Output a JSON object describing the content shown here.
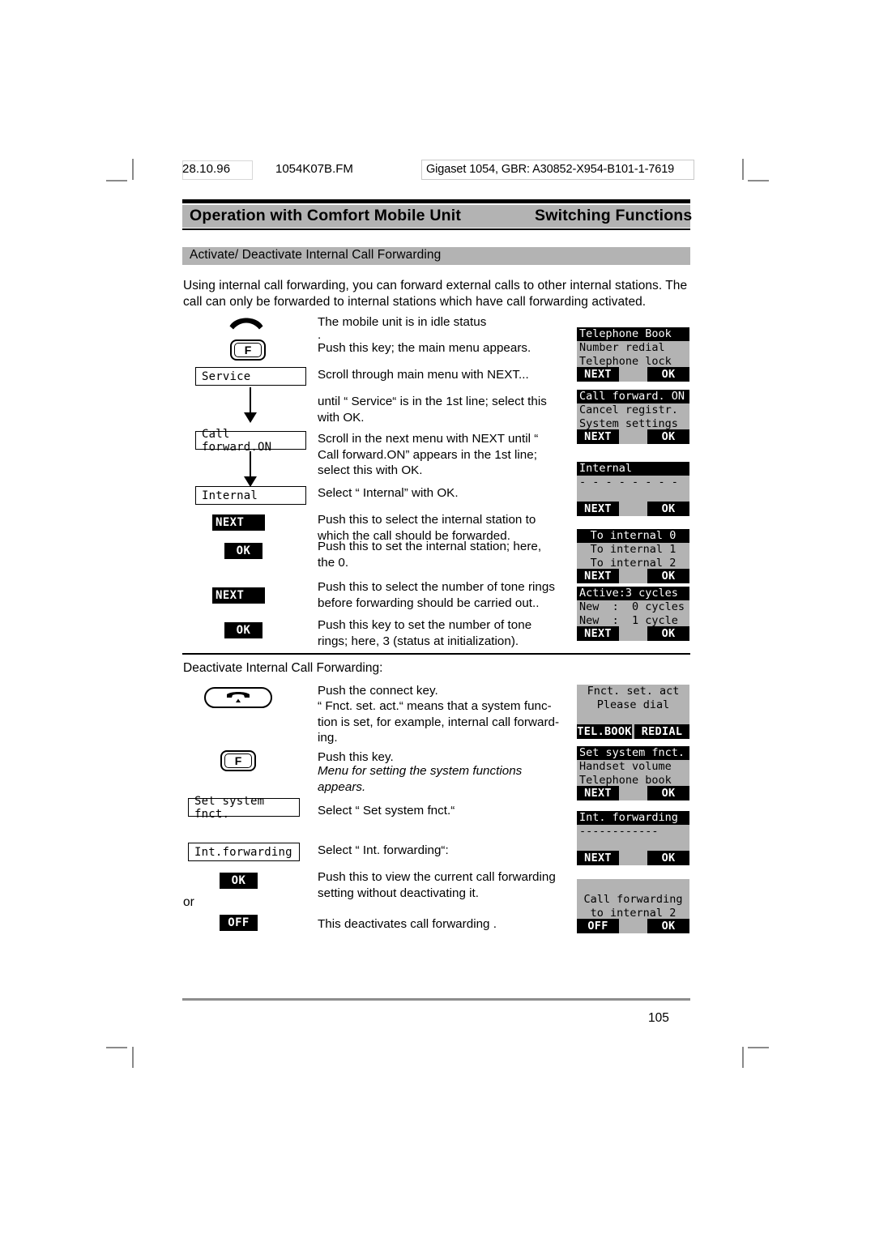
{
  "meta": {
    "date": "28.10.96",
    "filename": "1054K07B.FM",
    "doc_id": "Gigaset 1054, GBR: A30852-X954-B101-1-7619",
    "page_number": "105"
  },
  "running_head": {
    "left": "Operation with Comfort Mobile Unit",
    "right": "Switching Functions"
  },
  "section": {
    "title": "Activate/ Deactivate Internal Call Forwarding",
    "intro": "Using internal call forwarding, you can forward external calls to other internal stations. The call can only be forwarded to internal stations which have call forwarding activated.",
    "subhead": "Deactivate Internal Call Forwarding:",
    "or_label": "or"
  },
  "keys": {
    "f_label": "F",
    "handset_icon": "handset-idle-icon",
    "connect_icon": "connect-key-icon"
  },
  "flow_boxes": {
    "service": "Service",
    "call_forward_on": "Call forward.ON",
    "internal": "Internal",
    "set_system_fnct": "Set system fnct.",
    "int_forwarding": "Int.forwarding"
  },
  "chips": {
    "next": "NEXT",
    "ok": "OK",
    "off": "OFF"
  },
  "steps": [
    {
      "text": "The mobile unit is in idle status"
    },
    {
      "text": "."
    },
    {
      "text": "Push this key; the main menu appears."
    },
    {
      "text": "Scroll through main menu with NEXT..."
    },
    {
      "text": "until “ Service“ is in the 1st line; select this with OK."
    },
    {
      "text": "Scroll in the next menu with NEXT until “ Call forward.ON” appears in the 1st line; select this with OK."
    },
    {
      "text": "Select “ Internal” with OK."
    },
    {
      "text": "Push this to select the internal station to which the call should be forwarded."
    },
    {
      "text": "Push this to set the internal station; here, the 0."
    },
    {
      "text": "Push this to select the number of tone rings before forwarding should be carried out.."
    },
    {
      "text": "Push this key to set the number of tone rings; here, 3 (status at initialization)."
    },
    {
      "text": "Push the connect key."
    },
    {
      "text": "“ Fnct. set. act.“ means that a system func-tion is set, for example, internal call forward-ing."
    },
    {
      "text": "Push this key."
    },
    {
      "text": "Menu for setting the system functions appears."
    },
    {
      "text": "Select “ Set system fnct.“"
    },
    {
      "text": "Select “ Int. forwarding“:"
    },
    {
      "text": "Push this to view the current call forwarding setting without deactivating it."
    },
    {
      "text": "This deactivates call forwarding ."
    }
  ],
  "displays": [
    {
      "name": "telephone-book-menu",
      "lines": [
        {
          "text": "Telephone Book",
          "inverted": true,
          "align": "left"
        },
        {
          "text": "Number redial",
          "inverted": false,
          "align": "left"
        },
        {
          "text": "Telephone lock",
          "inverted": false,
          "align": "left"
        }
      ],
      "softkeys": [
        {
          "label": "NEXT",
          "side": "left"
        },
        {
          "label": "OK",
          "side": "right"
        }
      ]
    },
    {
      "name": "call-forward-on-menu",
      "lines": [
        {
          "text": "Call forward. ON",
          "inverted": true,
          "align": "left"
        },
        {
          "text": "Cancel registr.",
          "inverted": false,
          "align": "left"
        },
        {
          "text": "System settings",
          "inverted": false,
          "align": "left"
        }
      ],
      "softkeys": [
        {
          "label": "NEXT",
          "side": "left"
        },
        {
          "label": "OK",
          "side": "right"
        }
      ]
    },
    {
      "name": "internal-menu",
      "lines": [
        {
          "text": "Internal",
          "inverted": true,
          "align": "left"
        },
        {
          "text": "- - - - - - - -",
          "inverted": false,
          "align": "left"
        },
        {
          "text": "",
          "inverted": false,
          "align": "left"
        }
      ],
      "softkeys": [
        {
          "label": "NEXT",
          "side": "left"
        },
        {
          "label": "OK",
          "side": "right"
        }
      ]
    },
    {
      "name": "to-internal-menu",
      "lines": [
        {
          "text": "To internal 0",
          "inverted": true,
          "align": "center"
        },
        {
          "text": "To internal 1",
          "inverted": false,
          "align": "center"
        },
        {
          "text": "To internal 2",
          "inverted": false,
          "align": "center"
        }
      ],
      "softkeys": [
        {
          "label": "NEXT",
          "side": "left"
        },
        {
          "label": "OK",
          "side": "right"
        }
      ]
    },
    {
      "name": "tone-cycles-menu",
      "lines": [
        {
          "text": "Active:3 cycles",
          "inverted": true,
          "align": "left"
        },
        {
          "text": "New  :  0 cycles",
          "inverted": false,
          "align": "left"
        },
        {
          "text": "New  :  1 cycle",
          "inverted": false,
          "align": "left"
        }
      ],
      "softkeys": [
        {
          "label": "NEXT",
          "side": "left"
        },
        {
          "label": "OK",
          "side": "right"
        }
      ]
    },
    {
      "name": "fnct-set-act-display",
      "lines": [
        {
          "text": "Fnct. set. act",
          "inverted": false,
          "align": "center"
        },
        {
          "text": "Please dial",
          "inverted": false,
          "align": "center"
        },
        {
          "text": "",
          "inverted": false,
          "align": "left"
        }
      ],
      "softkeys": [
        {
          "label": "TEL.BOOK",
          "side": "left"
        },
        {
          "label": "REDIAL",
          "side": "right"
        }
      ]
    },
    {
      "name": "set-system-fnct-menu",
      "lines": [
        {
          "text": "Set system fnct.",
          "inverted": true,
          "align": "left"
        },
        {
          "text": "Handset volume",
          "inverted": false,
          "align": "left"
        },
        {
          "text": "Telephone book",
          "inverted": false,
          "align": "left"
        }
      ],
      "softkeys": [
        {
          "label": "NEXT",
          "side": "left"
        },
        {
          "label": "OK",
          "side": "right"
        }
      ]
    },
    {
      "name": "int-forwarding-menu",
      "lines": [
        {
          "text": "Int. forwarding",
          "inverted": true,
          "align": "left"
        },
        {
          "text": "------------",
          "inverted": false,
          "align": "left"
        },
        {
          "text": "",
          "inverted": false,
          "align": "left"
        }
      ],
      "softkeys": [
        {
          "label": "NEXT",
          "side": "left"
        },
        {
          "label": "OK",
          "side": "right"
        }
      ]
    },
    {
      "name": "call-forwarding-status-display",
      "lines": [
        {
          "text": "",
          "inverted": false,
          "align": "left"
        },
        {
          "text": "Call forwarding",
          "inverted": false,
          "align": "center"
        },
        {
          "text": "to internal 2",
          "inverted": false,
          "align": "center"
        }
      ],
      "softkeys": [
        {
          "label": "OFF",
          "side": "left"
        },
        {
          "label": "OK",
          "side": "right"
        }
      ]
    }
  ]
}
